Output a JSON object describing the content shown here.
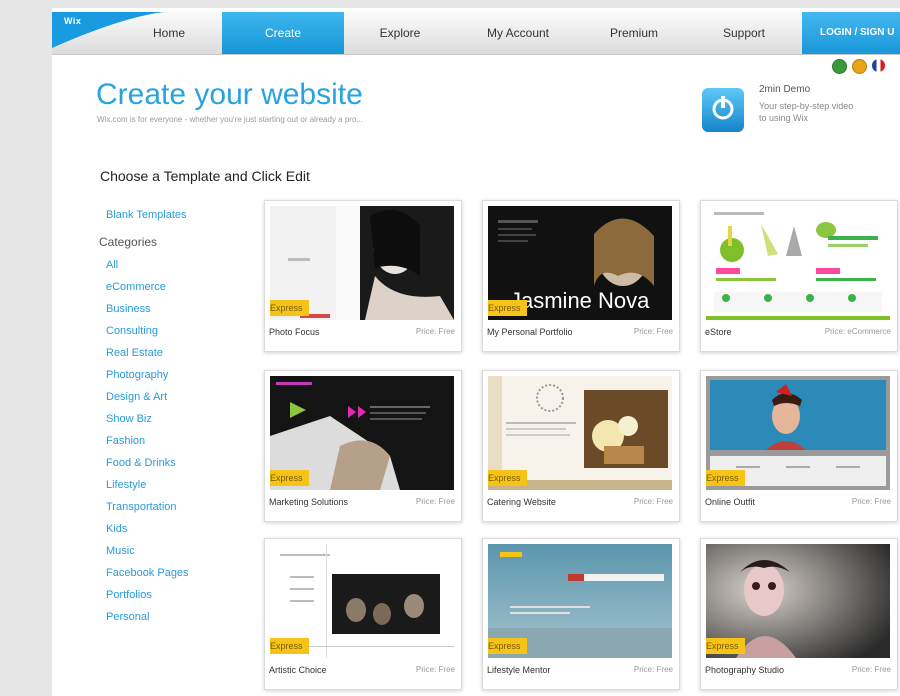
{
  "nav": {
    "logo": "Wix",
    "items": [
      "Home",
      "Create",
      "Explore",
      "My Account",
      "Premium",
      "Support"
    ],
    "login": "LOGIN / SIGN U"
  },
  "header": {
    "title": "Create your website",
    "subtitle": "Wix.com is for everyone - whether you're just starting out or already a pro..."
  },
  "demo": {
    "title": "2min Demo",
    "text": "Your step-by-step video to using Wix"
  },
  "section_heading": "Choose a Template and Click Edit",
  "sidebar": {
    "blank": "Blank Templates",
    "categories_heading": "Categories",
    "categories": [
      "All",
      "eCommerce",
      "Business",
      "Consulting",
      "Real Estate",
      "Photography",
      "Design & Art",
      "Show Biz",
      "Fashion",
      "Food & Drinks",
      "Lifestyle",
      "Transportation",
      "Kids",
      "Music",
      "Facebook Pages",
      "Portfolios",
      "Personal"
    ]
  },
  "templates": [
    {
      "name": "Photo Focus",
      "price": "Price: Free",
      "badge": "Express"
    },
    {
      "name": "My Personal Portfolio",
      "price": "Price: Free",
      "badge": "Express",
      "overlay": "Jasmine Nova"
    },
    {
      "name": "eStore",
      "price": "Price: eCommerce",
      "badge": ""
    },
    {
      "name": "Marketing Solutions",
      "price": "Price: Free",
      "badge": "Express"
    },
    {
      "name": "Catering Website",
      "price": "Price: Free",
      "badge": "Express"
    },
    {
      "name": "Online Outfit",
      "price": "Price: Free",
      "badge": "Express"
    },
    {
      "name": "Artistic Choice",
      "price": "Price: Free",
      "badge": "Express"
    },
    {
      "name": "Lifestyle Mentor",
      "price": "Price: Free",
      "badge": "Express"
    },
    {
      "name": "Photography Studio",
      "price": "Price: Free",
      "badge": "Express"
    }
  ],
  "colors": {
    "accent": "#29a3e0",
    "link": "#2a9ad9",
    "badge": "#f6c418"
  }
}
